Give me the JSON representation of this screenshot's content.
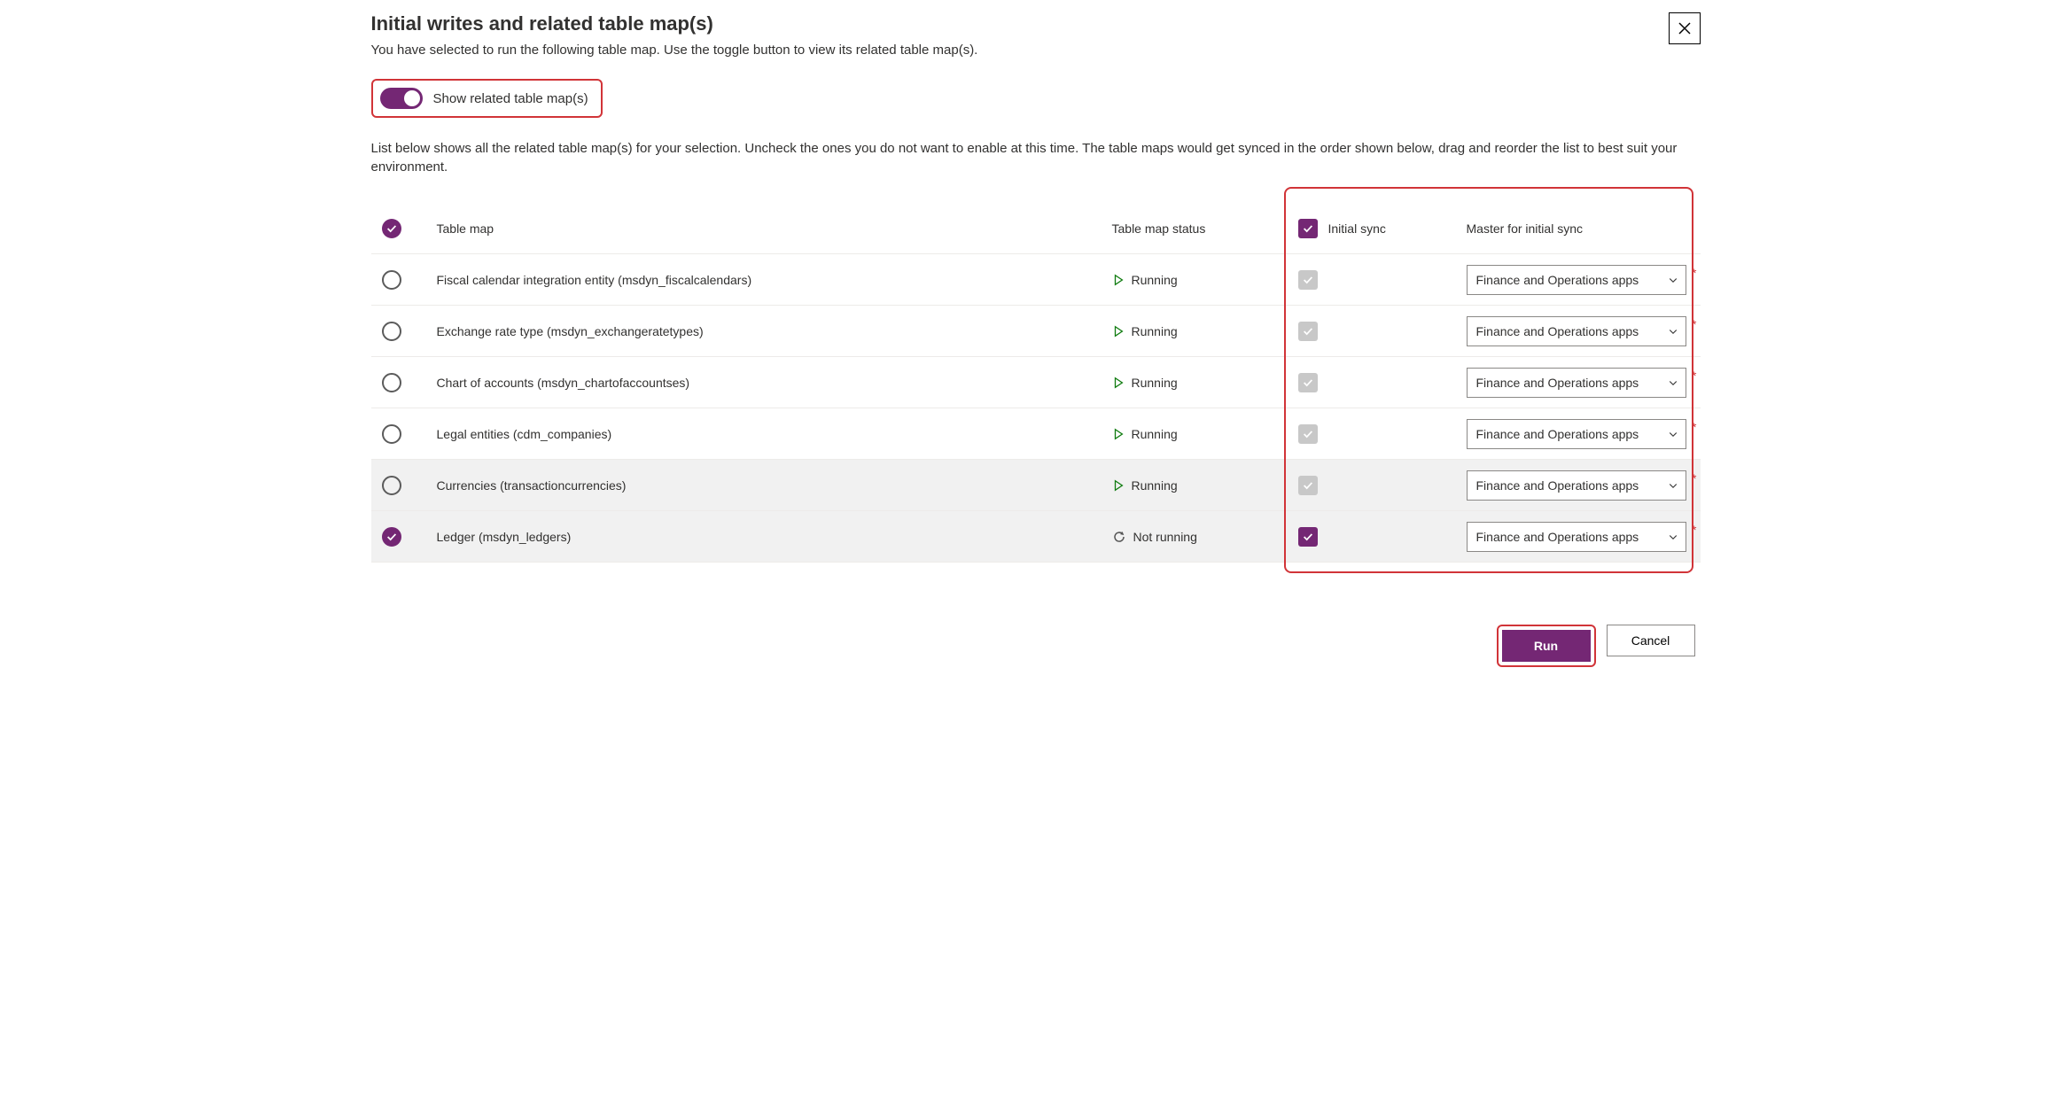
{
  "header": {
    "title": "Initial writes and related table map(s)",
    "subtitle": "You have selected to run the following table map. Use the toggle button to view its related table map(s)."
  },
  "toggle": {
    "label": "Show related table map(s)",
    "on": true
  },
  "list_description": "List below shows all the related table map(s) for your selection. Uncheck the ones you do not want to enable at this time. The table maps would get synced in the order shown below, drag and reorder the list to best suit your environment.",
  "columns": {
    "table_map": "Table map",
    "status": "Table map status",
    "initial_sync": "Initial sync",
    "master": "Master for initial sync"
  },
  "master_option_default": "Finance and Operations apps",
  "status_labels": {
    "running": "Running",
    "not_running": "Not running"
  },
  "rows": [
    {
      "selected": false,
      "name": "Fiscal calendar integration entity (msdyn_fiscalcalendars)",
      "status": "running",
      "sync_checked": true,
      "sync_disabled": true,
      "master": "Finance and Operations apps",
      "required": true,
      "shaded": false
    },
    {
      "selected": false,
      "name": "Exchange rate type (msdyn_exchangeratetypes)",
      "status": "running",
      "sync_checked": true,
      "sync_disabled": true,
      "master": "Finance and Operations apps",
      "required": true,
      "shaded": false
    },
    {
      "selected": false,
      "name": "Chart of accounts (msdyn_chartofaccountses)",
      "status": "running",
      "sync_checked": true,
      "sync_disabled": true,
      "master": "Finance and Operations apps",
      "required": true,
      "shaded": false
    },
    {
      "selected": false,
      "name": "Legal entities (cdm_companies)",
      "status": "running",
      "sync_checked": true,
      "sync_disabled": true,
      "master": "Finance and Operations apps",
      "required": true,
      "shaded": false
    },
    {
      "selected": false,
      "name": "Currencies (transactioncurrencies)",
      "status": "running",
      "sync_checked": true,
      "sync_disabled": true,
      "master": "Finance and Operations apps",
      "required": true,
      "shaded": true
    },
    {
      "selected": true,
      "name": "Ledger (msdyn_ledgers)",
      "status": "not_running",
      "sync_checked": true,
      "sync_disabled": false,
      "master": "Finance and Operations apps",
      "required": true,
      "shaded": true
    }
  ],
  "footer": {
    "run": "Run",
    "cancel": "Cancel"
  }
}
